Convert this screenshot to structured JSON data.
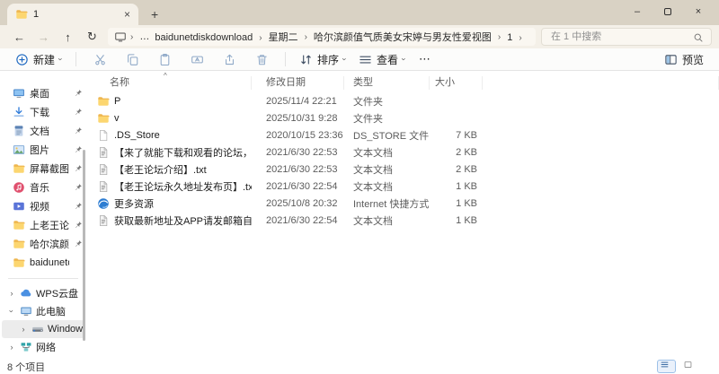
{
  "tab": {
    "title": "1",
    "icon": "folder-icon"
  },
  "chrome_glyphs": {
    "back": "←",
    "forward": "→",
    "up": "↑",
    "refresh": "↻",
    "close": "×",
    "minimize": "–",
    "new_tab": "+",
    "chevron": "›",
    "ellipsis": "…",
    "more": "⋯",
    "sort_caret": "^"
  },
  "navigation": {
    "breadcrumb": {
      "root_icon": "computer-icon",
      "segments": [
        {
          "label": "baidunetdiskdownload"
        },
        {
          "label": "星期二"
        },
        {
          "label": "哈尔滨颜值气质美女宋婷与男友性爱视图"
        },
        {
          "label": "1"
        }
      ]
    },
    "search": {
      "placeholder": "在 1 中搜索",
      "icon": "search-icon"
    }
  },
  "toolbar": {
    "new_label": "新建",
    "sort_label": "排序",
    "view_label": "查看",
    "preview_label": "预览"
  },
  "sidebar": {
    "pinned": [
      {
        "label": "桌面",
        "icon": "desktop-icon",
        "pinned": true
      },
      {
        "label": "下载",
        "icon": "downloads-icon",
        "pinned": true
      },
      {
        "label": "文档",
        "icon": "documents-icon",
        "pinned": true
      },
      {
        "label": "图片",
        "icon": "pictures-icon",
        "pinned": true
      },
      {
        "label": "屏幕截图",
        "icon": "folder-icon",
        "pinned": true
      },
      {
        "label": "音乐",
        "icon": "music-icon",
        "pinned": true
      },
      {
        "label": "视频",
        "icon": "videos-icon",
        "pinned": true
      },
      {
        "label": "上老王论坛当",
        "icon": "folder-icon",
        "pinned": true
      },
      {
        "label": "哈尔滨颜值气",
        "icon": "folder-icon",
        "pinned": true
      },
      {
        "label": "baidunetdiskdo",
        "icon": "folder-icon",
        "pinned": false
      }
    ],
    "tree": [
      {
        "label": "WPS云盘",
        "icon": "cloud-icon",
        "chevron": "collapsed",
        "indent": 0,
        "selected": false
      },
      {
        "label": "此电脑",
        "icon": "computer-icon",
        "chevron": "expanded",
        "indent": 0,
        "selected": false
      },
      {
        "label": "Windows-SSD",
        "icon": "drive-icon",
        "chevron": "collapsed",
        "indent": 1,
        "selected": true
      },
      {
        "label": "网络",
        "icon": "network-icon",
        "chevron": "collapsed",
        "indent": 0,
        "selected": false
      }
    ]
  },
  "file_list": {
    "columns": {
      "name": "名称",
      "date": "修改日期",
      "type": "类型",
      "size": "大小"
    },
    "rows": [
      {
        "name": "P",
        "icon": "folder-icon",
        "date": "2025/11/4 22:21",
        "type": "文件夹",
        "size": ""
      },
      {
        "name": "v",
        "icon": "folder-icon",
        "date": "2025/10/31 9:28",
        "type": "文件夹",
        "size": ""
      },
      {
        "name": ".DS_Store",
        "icon": "file-icon",
        "date": "2020/10/15 23:36",
        "type": "DS_STORE 文件",
        "size": "7 KB"
      },
      {
        "name": "【来了就能下载和观看的论坛，纯免费！】.txt",
        "icon": "text-file-icon",
        "date": "2021/6/30 22:53",
        "type": "文本文档",
        "size": "2 KB"
      },
      {
        "name": "【老王论坛介绍】.txt",
        "icon": "text-file-icon",
        "date": "2021/6/30 22:53",
        "type": "文本文档",
        "size": "2 KB"
      },
      {
        "name": "【老王论坛永久地址发布页】.txt",
        "icon": "text-file-icon",
        "date": "2021/6/30 22:54",
        "type": "文本文档",
        "size": "1 KB"
      },
      {
        "name": "更多资源",
        "icon": "internet-shortcut-icon",
        "date": "2025/10/8 20:32",
        "type": "Internet 快捷方式",
        "size": "1 KB"
      },
      {
        "name": "获取最新地址及APP请发邮箱自动获取.txt",
        "icon": "text-file-icon",
        "date": "2021/6/30 22:54",
        "type": "文本文档",
        "size": "1 KB"
      }
    ]
  },
  "status_bar": {
    "items_count": "8 个项目"
  },
  "colors": {
    "titlebar": "#d9d2c4",
    "chrome": "#f4f0e8",
    "accent": "#1a66c0",
    "selection": "#ececec"
  }
}
